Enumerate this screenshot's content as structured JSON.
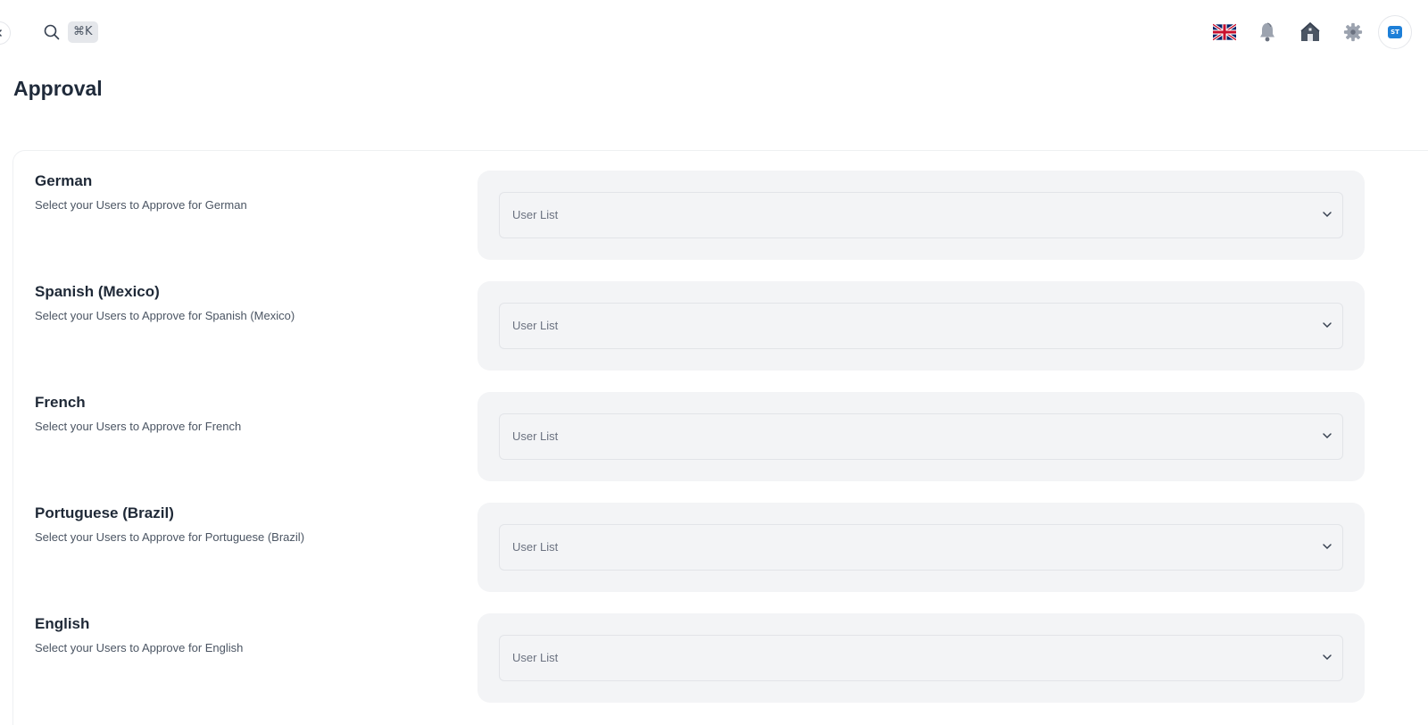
{
  "topbar": {
    "search_shortcut": "⌘K",
    "icons": [
      "search-icon",
      "uk-flag-icon",
      "bell-icon",
      "house-icon",
      "gear-icon",
      "avatar"
    ],
    "avatar_initials": "ST"
  },
  "page": {
    "title": "Approval"
  },
  "languages": [
    {
      "title": "German",
      "description": "Select your Users to Approve for German",
      "placeholder": "User List"
    },
    {
      "title": "Spanish (Mexico)",
      "description": "Select your Users to Approve for Spanish (Mexico)",
      "placeholder": "User List"
    },
    {
      "title": "French",
      "description": "Select your Users to Approve for French",
      "placeholder": "User List"
    },
    {
      "title": "Portuguese (Brazil)",
      "description": "Select your Users to Approve for Portuguese (Brazil)",
      "placeholder": "User List"
    },
    {
      "title": "English",
      "description": "Select your Users to Approve for English",
      "placeholder": "User List"
    }
  ],
  "colors": {
    "panel_bg": "#f3f4f6",
    "text_primary": "#1f2937",
    "text_secondary": "#4b5563",
    "avatar_accent": "#1d7fd8"
  }
}
